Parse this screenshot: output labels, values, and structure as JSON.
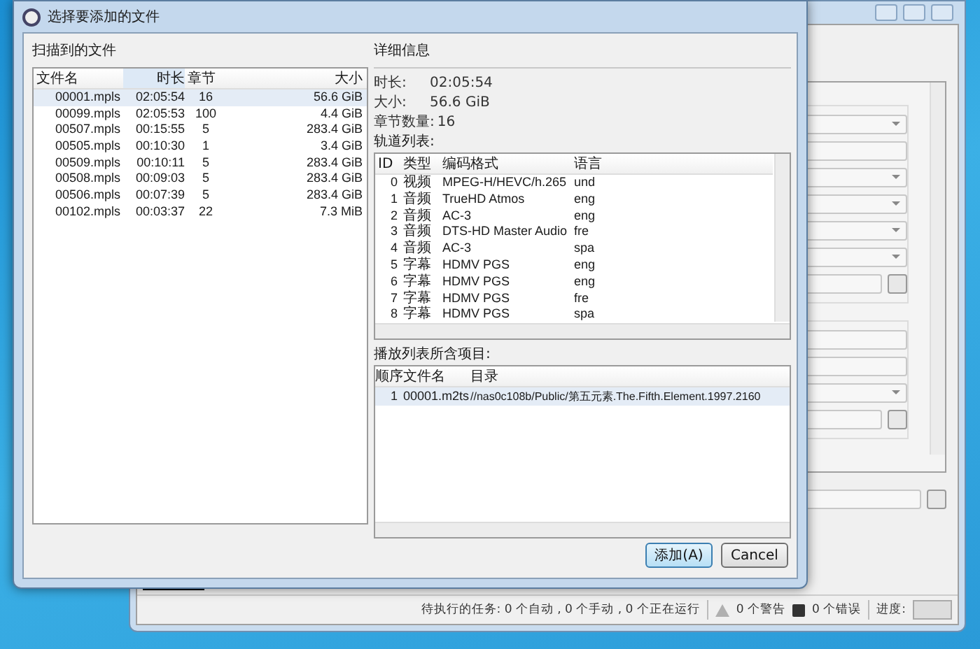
{
  "dialog": {
    "title": "选择要添加的文件"
  },
  "files": {
    "label": "扫描到的文件",
    "columns": [
      "文件名",
      "时长",
      "章节",
      "大小"
    ],
    "rows": [
      {
        "name": "00001.mpls",
        "duration": "02:05:54",
        "chapters": "16",
        "size": "56.6 GiB",
        "selected": true
      },
      {
        "name": "00099.mpls",
        "duration": "02:05:53",
        "chapters": "100",
        "size": "4.4 GiB",
        "selected": false
      },
      {
        "name": "00507.mpls",
        "duration": "00:15:55",
        "chapters": "5",
        "size": "283.4 GiB",
        "selected": false
      },
      {
        "name": "00505.mpls",
        "duration": "00:10:30",
        "chapters": "1",
        "size": "3.4 GiB",
        "selected": false
      },
      {
        "name": "00509.mpls",
        "duration": "00:10:11",
        "chapters": "5",
        "size": "283.4 GiB",
        "selected": false
      },
      {
        "name": "00508.mpls",
        "duration": "00:09:03",
        "chapters": "5",
        "size": "283.4 GiB",
        "selected": false
      },
      {
        "name": "00506.mpls",
        "duration": "00:07:39",
        "chapters": "5",
        "size": "283.4 GiB",
        "selected": false
      },
      {
        "name": "00102.mpls",
        "duration": "00:03:37",
        "chapters": "22",
        "size": "7.3 MiB",
        "selected": false
      }
    ]
  },
  "details": {
    "label": "详细信息",
    "fields": [
      {
        "label": "时长:",
        "value": "02:05:54"
      },
      {
        "label": "大小:",
        "value": "56.6 GiB"
      },
      {
        "label": "章节数量:",
        "value": "16"
      }
    ],
    "tracks_label": "轨道列表:",
    "track_columns": [
      "ID",
      "类型",
      "编码格式",
      "语言"
    ],
    "tracks": [
      {
        "id": "0",
        "type": "视频",
        "codec": "MPEG-H/HEVC/h.265",
        "language": "und"
      },
      {
        "id": "1",
        "type": "音频",
        "codec": "TrueHD Atmos",
        "language": "eng"
      },
      {
        "id": "2",
        "type": "音频",
        "codec": "AC-3",
        "language": "eng"
      },
      {
        "id": "3",
        "type": "音频",
        "codec": "DTS-HD Master Audio",
        "language": "fre"
      },
      {
        "id": "4",
        "type": "音频",
        "codec": "AC-3",
        "language": "spa"
      },
      {
        "id": "5",
        "type": "字幕",
        "codec": "HDMV PGS",
        "language": "eng"
      },
      {
        "id": "6",
        "type": "字幕",
        "codec": "HDMV PGS",
        "language": "eng"
      },
      {
        "id": "7",
        "type": "字幕",
        "codec": "HDMV PGS",
        "language": "fre"
      },
      {
        "id": "8",
        "type": "字幕",
        "codec": "HDMV PGS",
        "language": "spa"
      }
    ],
    "playlist_label": "播放列表所含项目:",
    "playlist_columns": [
      "顺序",
      "文件名",
      "目录"
    ],
    "playlist_items": [
      {
        "order": "1",
        "file": "00001.m2ts",
        "directory": "//nas0c108b/Public/第五元素.The.Fifth.Element.1997.2160",
        "selected": true
      }
    ]
  },
  "buttons": [
    {
      "label": "添加(A)",
      "focused": true
    },
    {
      "label": "Cancel",
      "focused": false
    }
  ],
  "status_bar": {
    "tasks": "待执行的任务: 0 个自动 , 0 个手动 , 0 个正在运行",
    "warnings": "0 个警告",
    "errors": "0 个错误",
    "progress_label": "进度:",
    "level": 0
  }
}
